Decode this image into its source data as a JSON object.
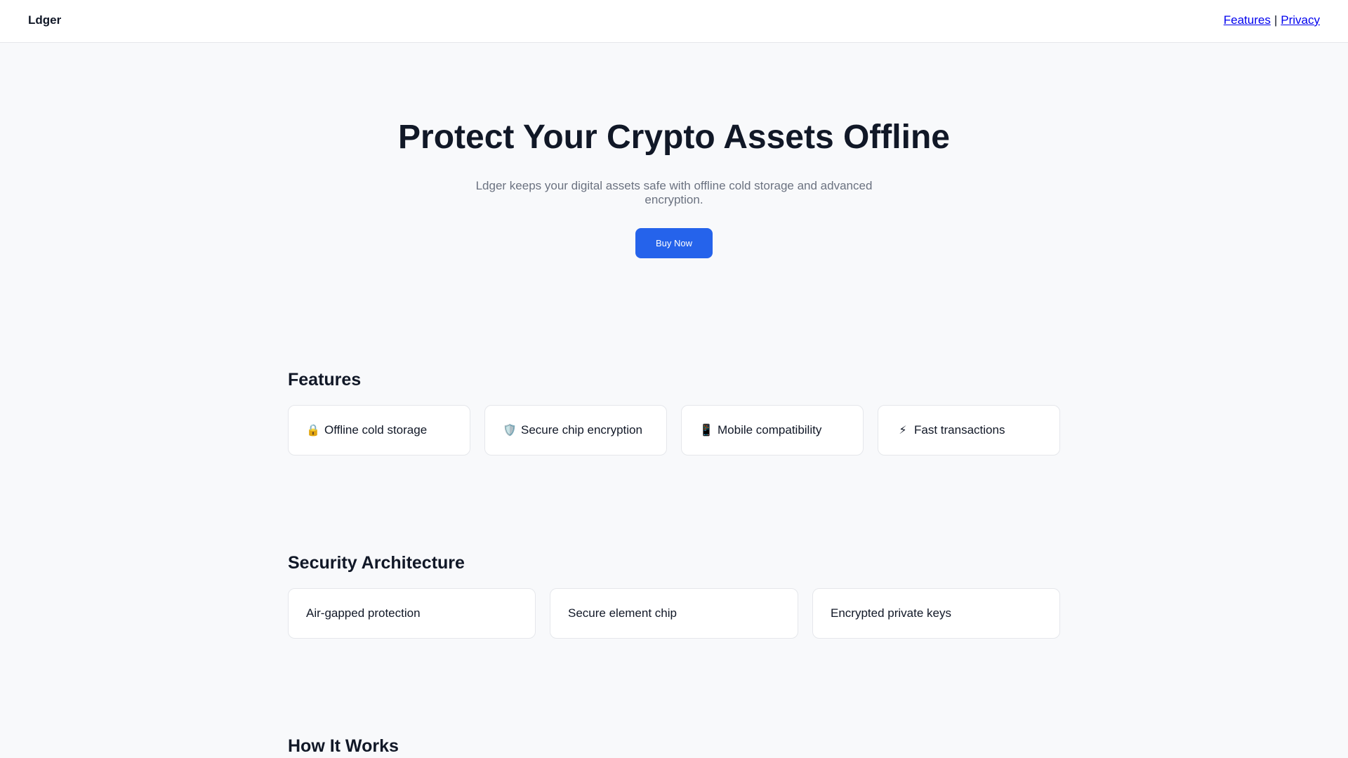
{
  "nav": {
    "brand": "Ldger",
    "links": [
      {
        "label": "Features"
      },
      {
        "label": "Privacy"
      }
    ],
    "separator": "|"
  },
  "hero": {
    "title": "Protect Your Crypto Assets Offline",
    "subtitle": "Ldger keeps your digital assets safe with offline cold storage and advanced encryption.",
    "cta_label": "Buy Now"
  },
  "features": {
    "title": "Features",
    "items": [
      {
        "icon": "lock-icon",
        "glyph": "🔒",
        "label": "Offline cold storage"
      },
      {
        "icon": "shield-icon",
        "glyph": "🛡️",
        "label": "Secure chip encryption"
      },
      {
        "icon": "mobile-phone-icon",
        "glyph": "📱",
        "label": "Mobile compatibility"
      },
      {
        "icon": "lightning-icon",
        "glyph": "⚡",
        "label": "Fast transactions"
      }
    ]
  },
  "security": {
    "title": "Security Architecture",
    "items": [
      {
        "label": "Air-gapped protection"
      },
      {
        "label": "Secure element chip"
      },
      {
        "label": "Encrypted private keys"
      }
    ]
  },
  "how_it_works": {
    "title": "How It Works"
  },
  "colors": {
    "accent": "#2563eb",
    "background": "#f8f9fb",
    "text": "#111827",
    "muted": "#6b7280"
  }
}
